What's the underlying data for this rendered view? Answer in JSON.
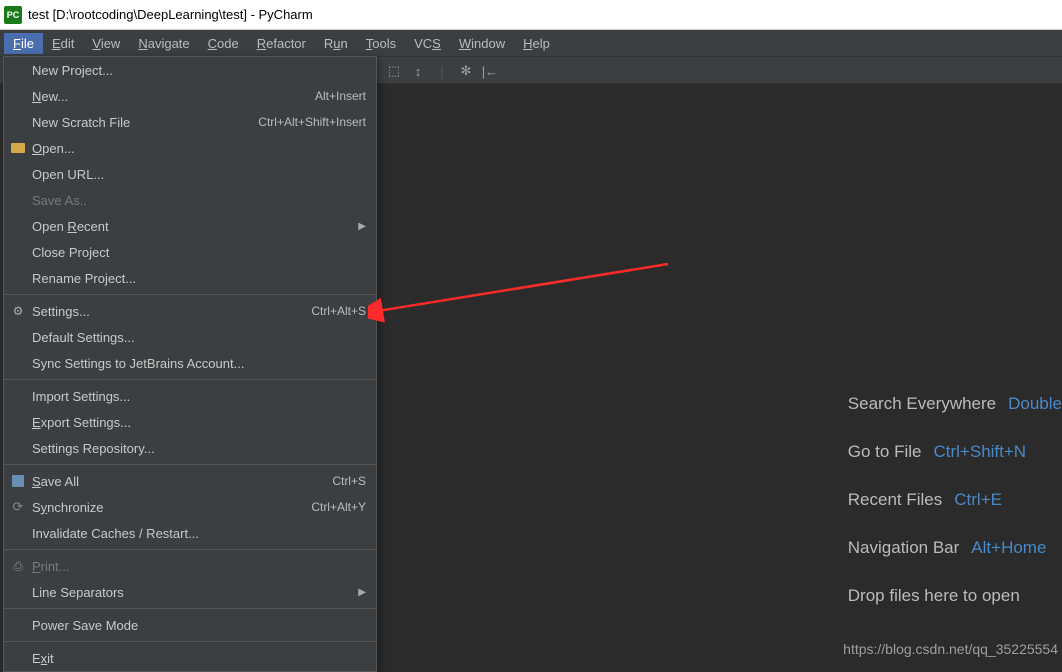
{
  "window": {
    "title": "test [D:\\rootcoding\\DeepLearning\\test] - PyCharm",
    "app_icon_text": "PC"
  },
  "menubar": {
    "items": [
      "File",
      "Edit",
      "View",
      "Navigate",
      "Code",
      "Refactor",
      "Run",
      "Tools",
      "VCS",
      "Window",
      "Help"
    ],
    "mnemonics": [
      "F",
      "E",
      "V",
      "N",
      "C",
      "R",
      "u",
      "T",
      "S",
      "W",
      "H"
    ]
  },
  "file_menu": {
    "groups": [
      [
        {
          "label": "New Project...",
          "shortcut": "",
          "icon": "",
          "disabled": false,
          "submenu": false,
          "mn": ""
        },
        {
          "label": "New...",
          "shortcut": "Alt+Insert",
          "icon": "",
          "disabled": false,
          "submenu": false,
          "mn": "N"
        },
        {
          "label": "New Scratch File",
          "shortcut": "Ctrl+Alt+Shift+Insert",
          "icon": "",
          "disabled": false,
          "submenu": false,
          "mn": ""
        },
        {
          "label": "Open...",
          "shortcut": "",
          "icon": "folder",
          "disabled": false,
          "submenu": false,
          "mn": "O"
        },
        {
          "label": "Open URL...",
          "shortcut": "",
          "icon": "",
          "disabled": false,
          "submenu": false,
          "mn": ""
        },
        {
          "label": "Save As..",
          "shortcut": "",
          "icon": "",
          "disabled": true,
          "submenu": false,
          "mn": ""
        },
        {
          "label": "Open Recent",
          "shortcut": "",
          "icon": "",
          "disabled": false,
          "submenu": true,
          "mn": "R"
        },
        {
          "label": "Close Project",
          "shortcut": "",
          "icon": "",
          "disabled": false,
          "submenu": false,
          "mn": ""
        },
        {
          "label": "Rename Project...",
          "shortcut": "",
          "icon": "",
          "disabled": false,
          "submenu": false,
          "mn": ""
        }
      ],
      [
        {
          "label": "Settings...",
          "shortcut": "Ctrl+Alt+S",
          "icon": "settings",
          "disabled": false,
          "submenu": false,
          "mn": ""
        },
        {
          "label": "Default Settings...",
          "shortcut": "",
          "icon": "",
          "disabled": false,
          "submenu": false,
          "mn": ""
        },
        {
          "label": "Sync Settings to JetBrains Account...",
          "shortcut": "",
          "icon": "",
          "disabled": false,
          "submenu": false,
          "mn": ""
        }
      ],
      [
        {
          "label": "Import Settings...",
          "shortcut": "",
          "icon": "",
          "disabled": false,
          "submenu": false,
          "mn": ""
        },
        {
          "label": "Export Settings...",
          "shortcut": "",
          "icon": "",
          "disabled": false,
          "submenu": false,
          "mn": "E"
        },
        {
          "label": "Settings Repository...",
          "shortcut": "",
          "icon": "",
          "disabled": false,
          "submenu": false,
          "mn": ""
        }
      ],
      [
        {
          "label": "Save All",
          "shortcut": "Ctrl+S",
          "icon": "save",
          "disabled": false,
          "submenu": false,
          "mn": "S"
        },
        {
          "label": "Synchronize",
          "shortcut": "Ctrl+Alt+Y",
          "icon": "sync",
          "disabled": false,
          "submenu": false,
          "mn": "y"
        },
        {
          "label": "Invalidate Caches / Restart...",
          "shortcut": "",
          "icon": "",
          "disabled": false,
          "submenu": false,
          "mn": ""
        }
      ],
      [
        {
          "label": "Print...",
          "shortcut": "",
          "icon": "print",
          "disabled": true,
          "submenu": false,
          "mn": "P"
        },
        {
          "label": "Line Separators",
          "shortcut": "",
          "icon": "",
          "disabled": false,
          "submenu": true,
          "mn": ""
        }
      ],
      [
        {
          "label": "Power Save Mode",
          "shortcut": "",
          "icon": "",
          "disabled": false,
          "submenu": false,
          "mn": ""
        }
      ],
      [
        {
          "label": "Exit",
          "shortcut": "",
          "icon": "",
          "disabled": false,
          "submenu": false,
          "mn": "x"
        }
      ]
    ]
  },
  "welcome": {
    "rows": [
      {
        "label": "Search Everywhere",
        "key": "Double"
      },
      {
        "label": "Go to File",
        "key": "Ctrl+Shift+N"
      },
      {
        "label": "Recent Files",
        "key": "Ctrl+E"
      },
      {
        "label": "Navigation Bar",
        "key": "Alt+Home"
      },
      {
        "label": "Drop files here to open",
        "key": ""
      }
    ]
  },
  "watermark": "https://blog.csdn.net/qq_35225554"
}
